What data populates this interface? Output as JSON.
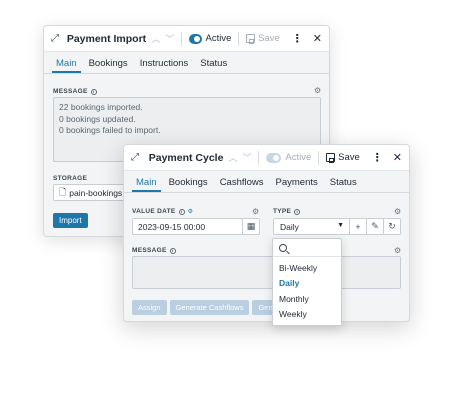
{
  "back_window": {
    "title": "Payment Import",
    "active_label": "Active",
    "save_label": "Save",
    "tabs": [
      "Main",
      "Bookings",
      "Instructions",
      "Status"
    ],
    "message_label": "MESSAGE",
    "message_lines": [
      "22 bookings imported.",
      "0 bookings updated.",
      "0 bookings failed to import."
    ],
    "storage_label": "STORAGE",
    "storage_value": "pain-bookings",
    "import_label": "Import"
  },
  "front_window": {
    "title": "Payment Cycle",
    "active_label": "Active",
    "save_label": "Save",
    "tabs": [
      "Main",
      "Bookings",
      "Cashflows",
      "Payments",
      "Status"
    ],
    "value_date_label": "VALUE DATE",
    "value_date": "2023-09-15 00:00",
    "type_label": "TYPE",
    "type_value": "Daily",
    "message_label": "MESSAGE",
    "buttons": [
      "Assign",
      "Generate Cashflows",
      "Gene"
    ]
  },
  "type_dropdown": {
    "options": [
      "Bi-Weekly",
      "Daily",
      "Monthly",
      "Weekly"
    ],
    "selected": "Daily"
  },
  "colors": {
    "accent": "#1f77a9",
    "muted_button": "#b9cfe1"
  }
}
